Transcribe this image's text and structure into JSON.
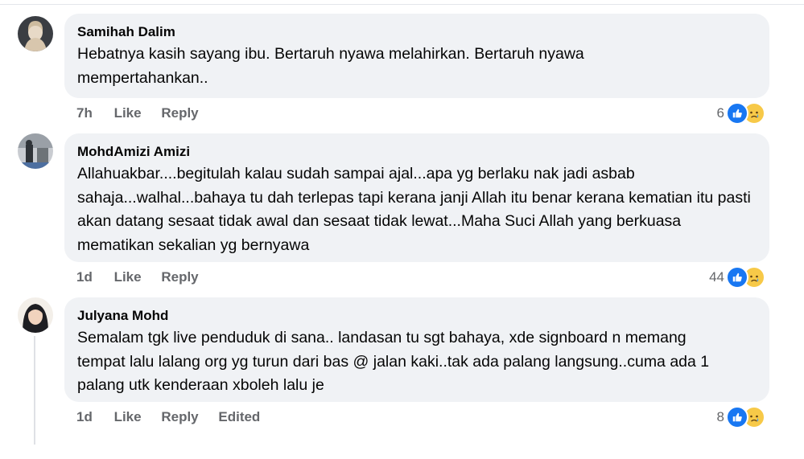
{
  "comments": [
    {
      "author": "Samihah Dalim",
      "text": "Hebatnya kasih sayang ibu. Bertaruh nyawa melahirkan. Bertaruh nyawa mempertahankan..",
      "time": "7h",
      "like_label": "Like",
      "reply_label": "Reply",
      "reaction_count": "6"
    },
    {
      "author": "MohdAmizi Amizi",
      "text": "Allahuakbar....begitulah kalau sudah sampai ajal...apa yg berlaku nak jadi asbab sahaja...walhal...bahaya tu dah terlepas tapi kerana janji Allah itu benar kerana kematian itu pasti akan datang sesaat tidak awal dan sesaat tidak lewat...Maha Suci Allah yang berkuasa mematikan sekalian yg bernyawa",
      "time": "1d",
      "like_label": "Like",
      "reply_label": "Reply",
      "reaction_count": "44"
    },
    {
      "author": "Julyana Mohd",
      "text": "Semalam tgk live penduduk di sana.. landasan tu sgt bahaya, xde signboard n memang tempat lalu lalang org yg turun dari bas @ jalan kaki..tak ada palang langsung..cuma ada 1 palang utk kenderaan xboleh lalu je",
      "time": "1d",
      "like_label": "Like",
      "reply_label": "Reply",
      "edited_label": "Edited",
      "reaction_count": "8"
    }
  ],
  "icons": {
    "reaction_1": "like-icon",
    "reaction_2": "sad-icon"
  },
  "colors": {
    "like_blue": "#1877f2",
    "bubble_bg": "#f0f2f5",
    "meta_gray": "#65676b"
  }
}
